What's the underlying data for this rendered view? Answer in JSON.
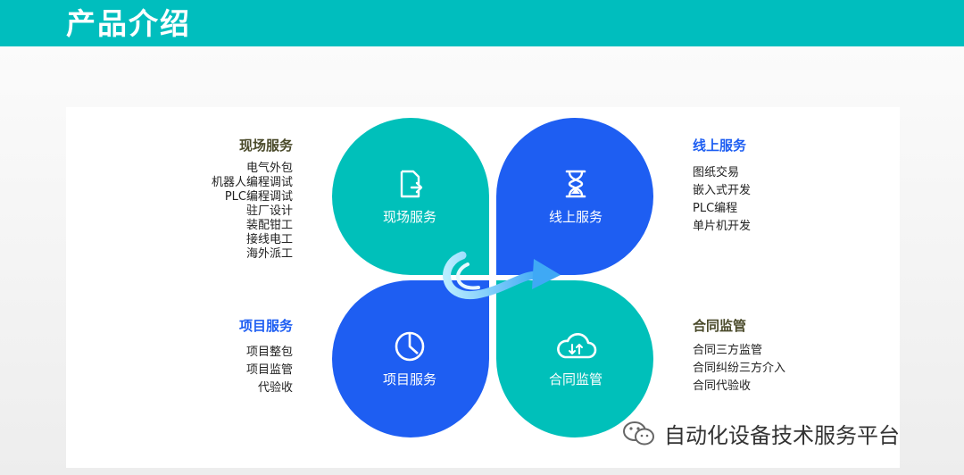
{
  "header": {
    "title": "产品介绍"
  },
  "petals": {
    "top_left": {
      "label": "现场服务",
      "icon": "document-arrow-icon"
    },
    "top_right": {
      "label": "线上服务",
      "icon": "hourglass-icon"
    },
    "bottom_left": {
      "label": "项目服务",
      "icon": "clock-icon"
    },
    "bottom_right": {
      "label": "合同监管",
      "icon": "cloud-sync-icon"
    }
  },
  "sections": {
    "onsite": {
      "title": "现场服务",
      "title_color": "#4a4a2a",
      "items": [
        "电气外包",
        "机器人编程调试",
        "PLC编程调试",
        "驻厂设计",
        "装配钳工",
        "接线电工",
        "海外派工"
      ]
    },
    "online": {
      "title": "线上服务",
      "title_color": "#1e5ef2",
      "items": [
        "图纸交易",
        "嵌入式开发",
        "PLC编程",
        "单片机开发"
      ]
    },
    "project": {
      "title": "项目服务",
      "title_color": "#1e5ef2",
      "items": [
        "项目整包",
        "项目监管",
        "代验收"
      ]
    },
    "contract": {
      "title": "合同监管",
      "title_color": "#4a4a2a",
      "items": [
        "合同三方监管",
        "合同纠纷三方介入",
        "合同代验收"
      ]
    }
  },
  "watermark": {
    "text": "自动化设备技术服务平台",
    "icon": "wechat-icon"
  },
  "colors": {
    "teal": "#00c0ba",
    "blue": "#1e5ef2",
    "header": "#00bebe"
  }
}
